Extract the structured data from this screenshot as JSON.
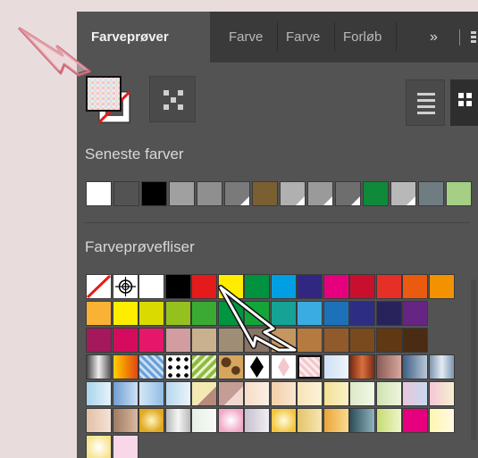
{
  "tabs": [
    {
      "label": "Farveprøver",
      "active": true
    },
    {
      "label": "Farve",
      "active": false
    },
    {
      "label": "Farve",
      "active": false
    },
    {
      "label": "Forløb",
      "active": false
    }
  ],
  "overflow_label": "»",
  "sections": {
    "recent_title": "Seneste farver",
    "tiles_title": "Farveprøvefliser"
  },
  "recent_colors": [
    "#ffffff",
    "#535353",
    "#000000",
    "#a0a0a0",
    "#8f8f8f",
    "#7a7a7a",
    "#7a5f33",
    "#b0b0b0",
    "#9a9a9a",
    "#6e6e6e",
    "#0f8a3a",
    "#b8b8b8",
    "#6f7d83",
    "#a4cf84"
  ],
  "swatch_rows": [
    [
      "none",
      "registration",
      "#ffffff",
      "#000000",
      "#e51a1a",
      "#ffec00",
      "#00923f",
      "#009fe3",
      "#312783",
      "#e6007e",
      "#c8102e",
      "#e53027",
      "#ea5a0f",
      "#f39200"
    ],
    [
      "#f9b233",
      "#ffed00",
      "#dada00",
      "#95c11f",
      "#3aaa35",
      "#009640",
      "#13a538",
      "#16a295",
      "#3aace2",
      "#1d71b8",
      "#2d2e83",
      "#29235c",
      "#662483"
    ],
    [
      "#a3195b",
      "#d50c5e",
      "#e6176a",
      "#d19da0",
      "#c9b08f",
      "#a08d76",
      "#8b7466",
      "#c59660",
      "#b57a3f",
      "#915a2c",
      "#7a4a1f",
      "#603813",
      "#4a2b14"
    ],
    [
      "grad-gray",
      "grad-orange",
      "pattern-blue",
      "pattern-dots",
      "pattern-green",
      "pattern-leopard",
      "diamond-black",
      "diamond-pink",
      "pattern-pastel",
      "grad-lightblue",
      "grad-rust",
      "grad-mauve",
      "grad-steel",
      "grad-silverblue"
    ],
    [
      "grad-skyblue",
      "grad-blue",
      "grad-lightblue2",
      "grad-paleblue",
      "grad-cream-diag",
      "grad-rose-diag",
      "grad-peach",
      "grad-apricot",
      "grad-cream",
      "grad-yellow",
      "grad-mint",
      "grad-green",
      "grad-lilac",
      "grad-pink"
    ],
    [
      "grad-tan",
      "grad-brown",
      "radial-gold",
      "grad-silver",
      "grad-pale",
      "radial-pink",
      "grad-grayish",
      "radial-yellow",
      "grad-gold",
      "grad-amber",
      "grad-darkteal",
      "grad-lime",
      "#e6007e",
      "grad-lightyellow"
    ],
    [
      "radial-lightyellow",
      "#f7d7e8"
    ]
  ]
}
